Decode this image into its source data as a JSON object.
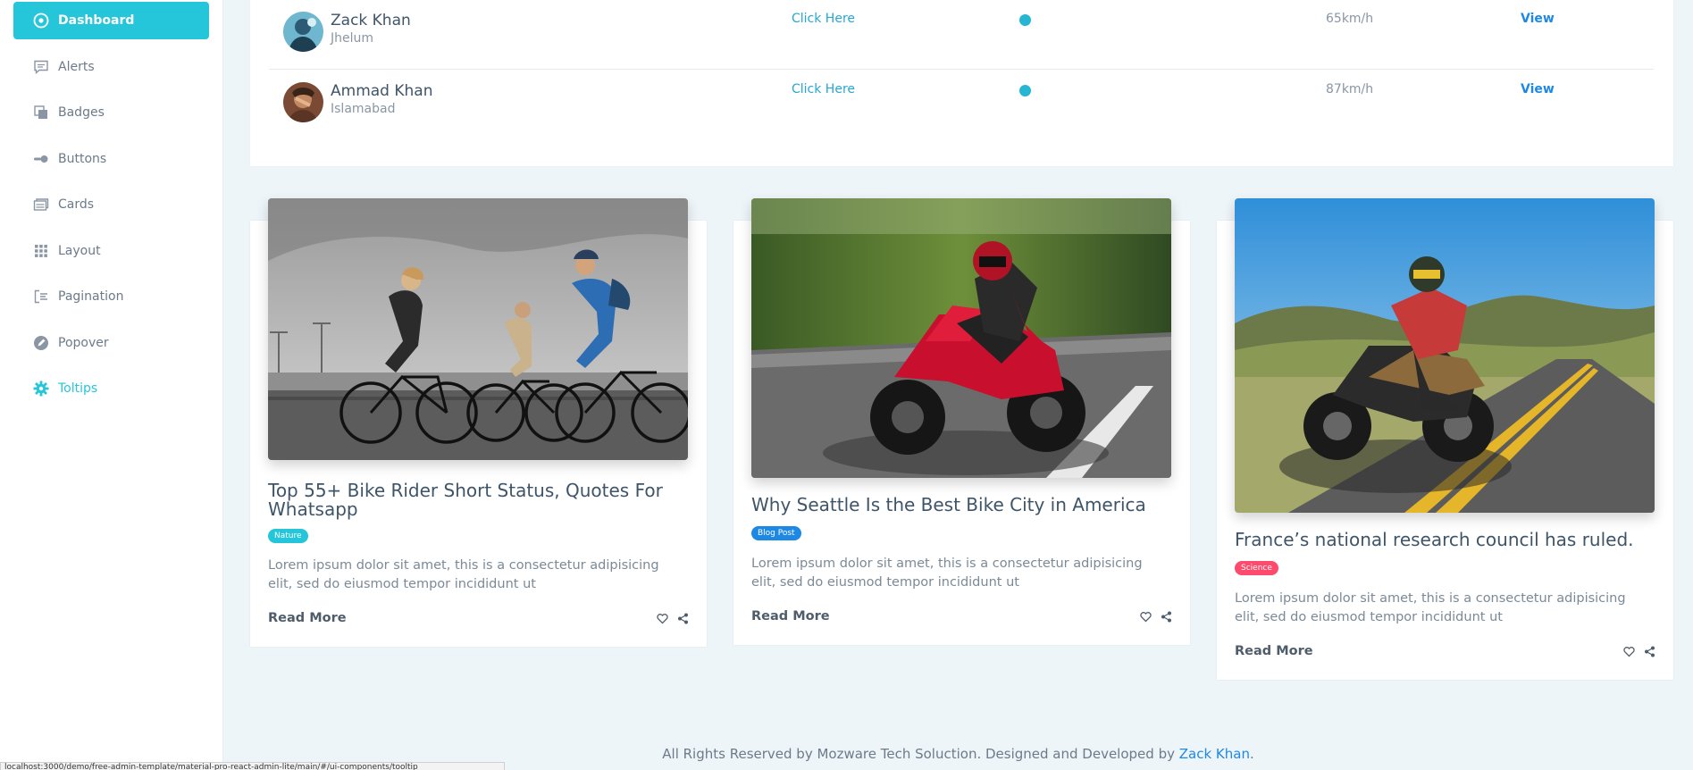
{
  "sidebar": {
    "items": [
      {
        "label": "Dashboard",
        "icon": "target-icon",
        "active": true
      },
      {
        "label": "Alerts",
        "icon": "comment-icon"
      },
      {
        "label": "Badges",
        "icon": "copy-icon"
      },
      {
        "label": "Buttons",
        "icon": "toggle-icon"
      },
      {
        "label": "Cards",
        "icon": "cards-icon"
      },
      {
        "label": "Layout",
        "icon": "grid-icon"
      },
      {
        "label": "Pagination",
        "icon": "list-icon"
      },
      {
        "label": "Popover",
        "icon": "edit-icon"
      },
      {
        "label": "Toltips",
        "icon": "gear-icon"
      }
    ]
  },
  "table": {
    "rows": [
      {
        "name": "Zack Khan",
        "location": "Jhelum",
        "link": "Click Here",
        "speed": "65km/h",
        "action": "View"
      },
      {
        "name": "Ammad Khan",
        "location": "Islamabad",
        "link": "Click Here",
        "speed": "87km/h",
        "action": "View"
      }
    ]
  },
  "blog": {
    "cards": [
      {
        "title": "Top 55+ Bike Rider Short Status, Quotes For Whatsapp",
        "badge": "Nature",
        "badge_color": "#26c6da",
        "description": "Lorem ipsum dolor sit amet, this is a consectetur adipisicing elit, sed do eiusmod tempor incididunt ut",
        "read_more": "Read More"
      },
      {
        "title": "Why Seattle Is the Best Bike City in America",
        "badge": "Blog Post",
        "badge_color": "#1e88e5",
        "description": "Lorem ipsum dolor sit amet, this is a consectetur adipisicing elit, sed do eiusmod tempor incididunt ut",
        "read_more": "Read More"
      },
      {
        "title": "France’s national research council has ruled.",
        "badge": "Science",
        "badge_color": "#fc4b6c",
        "description": "Lorem ipsum dolor sit amet, this is a consectetur adipisicing elit, sed do eiusmod tempor incididunt ut",
        "read_more": "Read More"
      }
    ]
  },
  "footer": {
    "text": "All Rights Reserved by Mozware Tech Soluction. Designed and Developed by",
    "author": "Zack Khan",
    "end": "."
  },
  "statusbar": {
    "url": "localhost:3000/demo/free-admin-template/material-pro-react-admin-lite/main/#/ui-components/tooltip"
  },
  "colors": {
    "accent": "#26c6da",
    "link": "#1e88e5",
    "sidebar_bg": "#ffffff",
    "page_bg": "#eef5f9"
  }
}
